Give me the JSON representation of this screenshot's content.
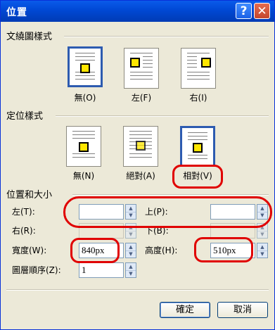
{
  "dialog": {
    "title": "位置",
    "help_glyph": "?",
    "close_glyph": "✕"
  },
  "wrap": {
    "header": "文繞圖樣式",
    "options": [
      {
        "label": "無(O)"
      },
      {
        "label": "左(F)"
      },
      {
        "label": "右(I)"
      }
    ],
    "selected": "無(O)"
  },
  "position": {
    "header": "定位樣式",
    "options": [
      {
        "label": "無(N)"
      },
      {
        "label": "絕對(A)"
      },
      {
        "label": "相對(V)"
      }
    ],
    "selected": "相對(V)"
  },
  "size": {
    "header": "位置和大小",
    "left_label": "左(T):",
    "left_value": "",
    "top_label": "上(P):",
    "top_value": "",
    "right_label": "右(R):",
    "right_value": "",
    "bottom_label": "下(B):",
    "bottom_value": "",
    "width_label": "寬度(W):",
    "width_value": "840px",
    "height_label": "高度(H):",
    "height_value": "510px",
    "zorder_label": "圖層順序(Z):",
    "zorder_value": "1"
  },
  "buttons": {
    "ok": "確定",
    "cancel": "取消"
  },
  "colors": {
    "titlebar": "#0048d4",
    "annotation": "#e00000",
    "accent_square": "#ffe600"
  }
}
